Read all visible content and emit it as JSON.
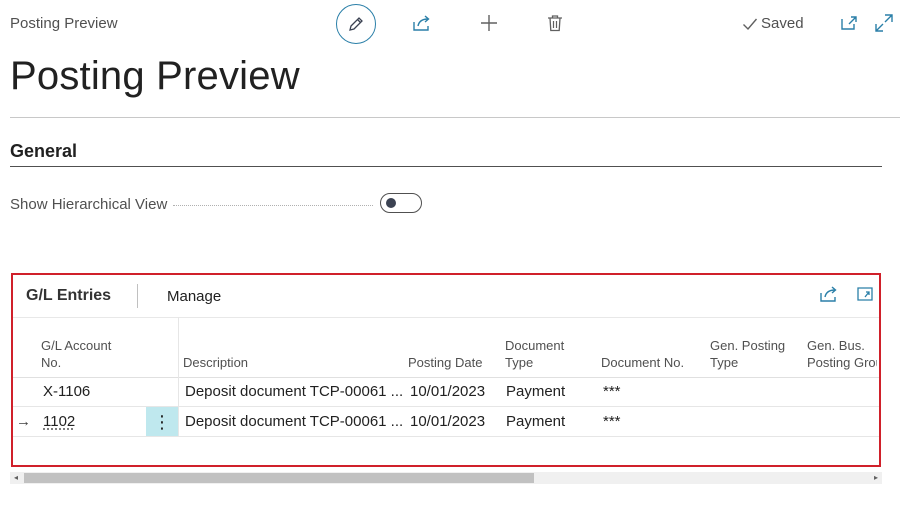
{
  "header": {
    "breadcrumb": "Posting Preview",
    "saved_label": "Saved",
    "page_title": "Posting Preview"
  },
  "general": {
    "section_title": "General",
    "show_hierarchical_label": "Show Hierarchical View",
    "show_hierarchical_value": false
  },
  "gl_entries": {
    "title": "G/L Entries",
    "manage_label": "Manage",
    "columns": {
      "account_1": "G/L Account",
      "account_2": "No.",
      "description": "Description",
      "posting_date": "Posting Date",
      "doc_type_1": "Document",
      "doc_type_2": "Type",
      "doc_no": "Document No.",
      "gen_posting_1": "Gen. Posting",
      "gen_posting_2": "Type",
      "gen_bus_1": "Gen. Bus.",
      "gen_bus_2": "Posting Grou"
    },
    "rows": [
      {
        "account": "X-1106",
        "description": "Deposit document TCP-00061 ...",
        "posting_date": "10/01/2023",
        "doc_type": "Payment",
        "doc_no": "***"
      },
      {
        "account": "1102",
        "description": "Deposit document TCP-00061 ...",
        "posting_date": "10/01/2023",
        "doc_type": "Payment",
        "doc_no": "***"
      }
    ],
    "row_indicator": "→",
    "row_menu": "⋮"
  },
  "icons": {
    "accent_color": "#2a7fa8",
    "highlight_color": "#d0202a"
  }
}
